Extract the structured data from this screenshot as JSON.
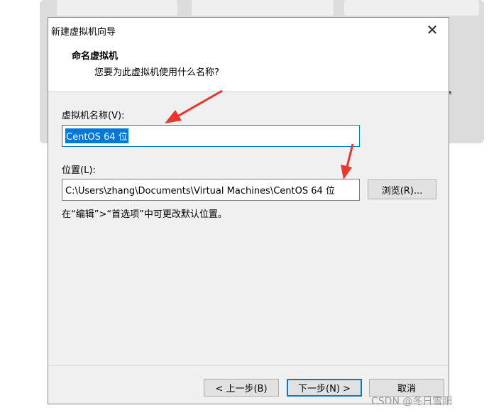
{
  "dialog": {
    "title": "新建虚拟机向导",
    "close_glyph": "✕",
    "header_title": "命名虚拟机",
    "header_subtitle": "您要为此虚拟机使用什么名称?",
    "name_label": "虚拟机名称(V):",
    "name_value": "CentOS 64 位",
    "location_label": "位置(L):",
    "location_value": "C:\\Users\\zhang\\Documents\\Virtual Machines\\CentOS 64 位",
    "browse_label": "浏览(R)...",
    "hint": "在“编辑”>“首选项”中可更改默认位置。",
    "back_label": "< 上一步(B)",
    "next_label": "下一步(N) >",
    "cancel_label": "取消"
  },
  "background": {
    "glyph": "ᵜ"
  },
  "watermark": "CSDN @冬日雪阳",
  "colors": {
    "accent": "#0078d7",
    "arrow": "#e8382e"
  }
}
